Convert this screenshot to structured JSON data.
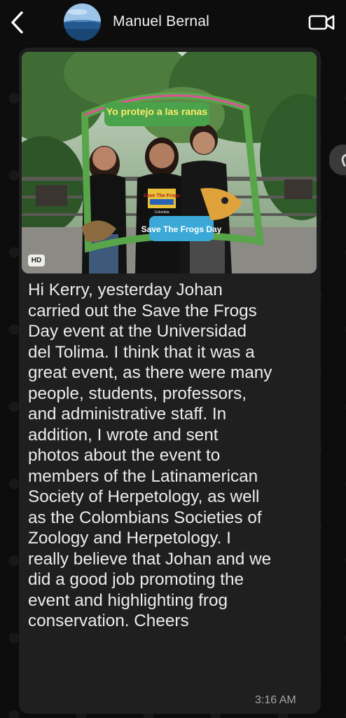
{
  "header": {
    "contact_name": "Manuel Bernal",
    "back_icon": "chevron-left-icon",
    "video_icon": "video-camera-icon"
  },
  "message": {
    "photo_badge": "HD",
    "text": "Hi Kerry, yesterday Johan\ncarried out the Save the Frogs\nDay event at the Universidad\ndel Tolima. I think that it was a\ngreat event, as there were many\npeople, students, professors,\nand administrative staff. In\naddition, I wrote and sent\nphotos about the event to\nmembers of the Latinamerican\nSociety of Herpetology, as well\nas the Colombians Societies of\nZoology and Herpetology. I\nreally believe that Johan and we\ndid a good job promoting the\nevent and highlighting frog\nconservation. Cheers",
    "time": "3:16 AM",
    "photo": {
      "frame_top_text": "Yo protejo a las ranas",
      "frame_bottom_text": "Save The Frogs Day",
      "shirt_text": "Save The Frogs",
      "shirt_subtext": "Colombia"
    }
  },
  "colors": {
    "background": "#0c0c0c",
    "bubble": "#1f1f1f",
    "text": "#ececec",
    "timestamp": "#a6a6a6"
  }
}
